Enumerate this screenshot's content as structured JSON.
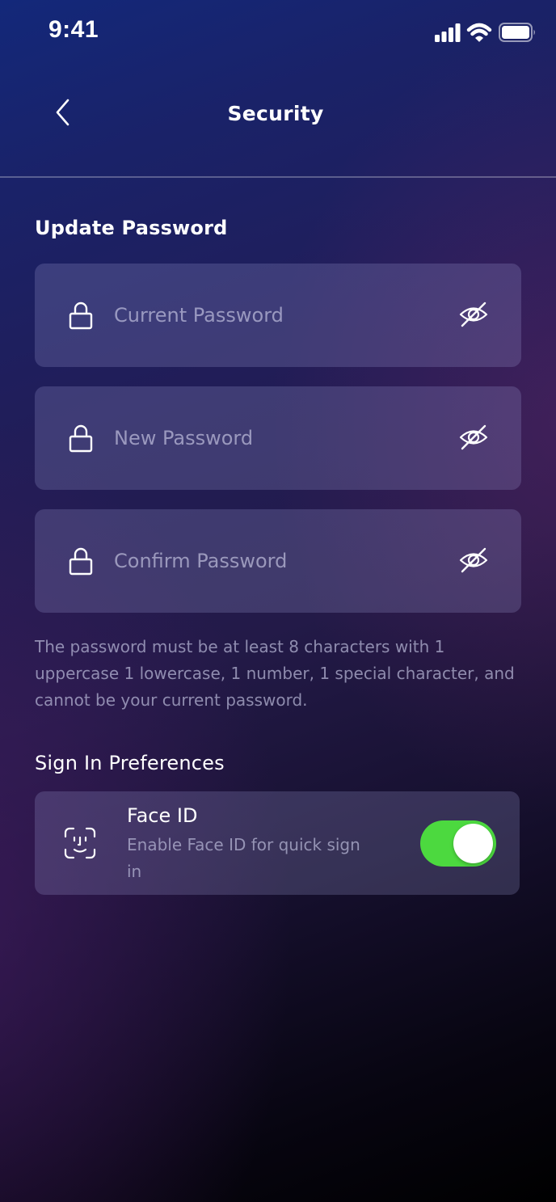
{
  "status_bar": {
    "time": "9:41",
    "icons": [
      "cellular-signal-icon",
      "wifi-icon",
      "battery-icon"
    ]
  },
  "nav": {
    "title": "Security",
    "back_icon": "chevron-left-icon"
  },
  "update_password": {
    "title": "Update Password",
    "fields": [
      {
        "placeholder": "Current Password",
        "value": "",
        "icon": "lock-icon",
        "toggle_icon": "eye-off-icon"
      },
      {
        "placeholder": "New Password",
        "value": "",
        "icon": "lock-icon",
        "toggle_icon": "eye-off-icon"
      },
      {
        "placeholder": "Confirm Password",
        "value": "",
        "icon": "lock-icon",
        "toggle_icon": "eye-off-icon"
      }
    ],
    "hint": "The password must be at least 8 characters with 1 uppercase 1 lowercase, 1 number, 1 special character, and cannot be your current password."
  },
  "sign_in_preferences": {
    "title": "Sign In Preferences",
    "face_id": {
      "title": "Face ID",
      "description": "Enable Face ID for quick sign in",
      "icon": "face-id-icon",
      "enabled": true
    }
  },
  "colors": {
    "toggle_on": "#4cd93f",
    "field_background": "#4f4f7a"
  }
}
